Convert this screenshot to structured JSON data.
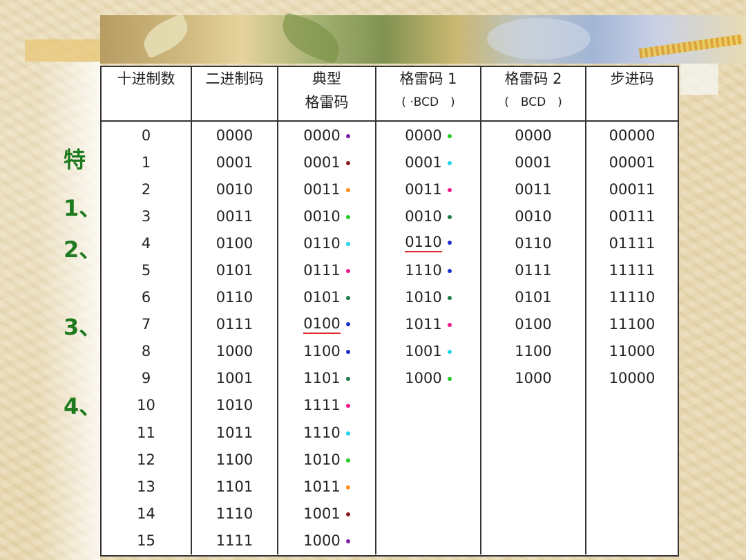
{
  "markers": [
    "特",
    "1、",
    "2、",
    "3、",
    "4、"
  ],
  "table": {
    "headers": [
      {
        "line1": "十进制数",
        "line2": ""
      },
      {
        "line1": "二进制码",
        "line2": ""
      },
      {
        "line1": "典型",
        "line2": "格雷码"
      },
      {
        "line1": "格雷码 1",
        "line2": "( ·BCD　)"
      },
      {
        "line1": "格雷码 2",
        "line2": "(　BCD　)"
      },
      {
        "line1": "步进码",
        "line2": ""
      }
    ],
    "rows": [
      [
        "0",
        "0000",
        "0000",
        "0000",
        "0000",
        "00000"
      ],
      [
        "1",
        "0001",
        "0001",
        "0001",
        "0001",
        "00001"
      ],
      [
        "2",
        "0010",
        "0011",
        "0011",
        "0011",
        "00011"
      ],
      [
        "3",
        "0011",
        "0010",
        "0010",
        "0010",
        "00111"
      ],
      [
        "4",
        "0100",
        "0110",
        "0110",
        "0110",
        "01111"
      ],
      [
        "5",
        "0101",
        "0111",
        "1110",
        "0111",
        "11111"
      ],
      [
        "6",
        "0110",
        "0101",
        "1010",
        "0101",
        "11110"
      ],
      [
        "7",
        "0111",
        "0100",
        "1011",
        "0100",
        "11100"
      ],
      [
        "8",
        "1000",
        "1100",
        "1001",
        "1100",
        "11000"
      ],
      [
        "9",
        "1001",
        "1101",
        "1000",
        "1000",
        "10000"
      ],
      [
        "10",
        "1010",
        "1111",
        "",
        "",
        ""
      ],
      [
        "11",
        "1011",
        "1110",
        "",
        "",
        ""
      ],
      [
        "12",
        "1100",
        "1010",
        "",
        "",
        ""
      ],
      [
        "13",
        "1101",
        "1011",
        "",
        "",
        ""
      ],
      [
        "14",
        "1110",
        "1001",
        "",
        "",
        ""
      ],
      [
        "15",
        "1111",
        "1000",
        "",
        "",
        ""
      ]
    ],
    "gray_dot_colors": [
      "#7b1fa2",
      "#8b1a1a",
      "#ff8c1a",
      "#22cc22",
      "#22d3ee",
      "#ee1a8a",
      "#1a7a4a",
      "#1a2ecc",
      "#1a2ecc",
      "#1a7a4a",
      "#ee1a8a",
      "#22d3ee",
      "#22cc22",
      "#ff8c1a",
      "#8b1a1a",
      "#7b1fa2"
    ],
    "gray1_dot_colors": [
      "#22cc22",
      "#22d3ee",
      "#ee1a8a",
      "#1a7a4a",
      "#1a2ecc",
      "#1a2ecc",
      "#1a7a4a",
      "#ee1a8a",
      "#22d3ee",
      "#22cc22"
    ],
    "underlined": {
      "gray_row": 7,
      "gray1_row": 4
    }
  }
}
